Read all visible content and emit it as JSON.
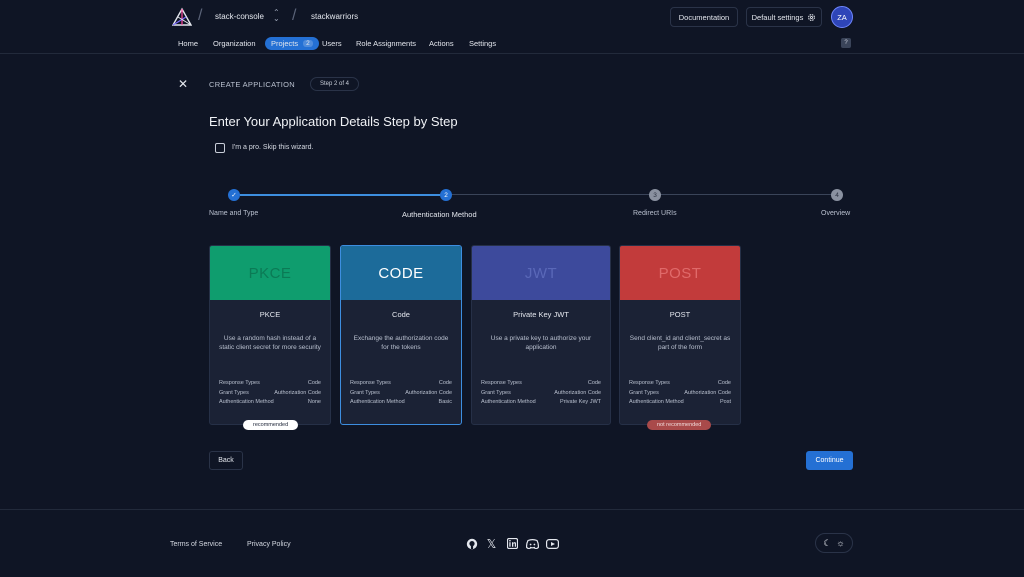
{
  "header": {
    "org_name": "stack-console",
    "instance_name": "stackwarriors",
    "documentation_label": "Documentation",
    "default_settings_label": "Default settings",
    "avatar_initials": "ZA"
  },
  "nav": {
    "items": [
      {
        "label": "Home"
      },
      {
        "label": "Organization"
      },
      {
        "label": "Projects",
        "count": "2"
      },
      {
        "label": "Users"
      },
      {
        "label": "Role Assignments"
      },
      {
        "label": "Actions"
      },
      {
        "label": "Settings"
      }
    ],
    "help_label": "?"
  },
  "wizard": {
    "close_icon": "close-icon",
    "create_label": "CREATE APPLICATION",
    "step_indicator": "Step 2 of 4",
    "title": "Enter Your Application Details Step by Step",
    "skip_label": "I'm a pro. Skip this wizard.",
    "skip_checked": false,
    "steps": [
      {
        "number": "1",
        "label": "Name and Type",
        "state": "done"
      },
      {
        "number": "2",
        "label": "Authentication Method",
        "state": "current"
      },
      {
        "number": "3",
        "label": "Redirect URIs",
        "state": "pending"
      },
      {
        "number": "4",
        "label": "Overview",
        "state": "pending"
      }
    ],
    "prop_labels": [
      "Response Types",
      "Grant Types",
      "Authentication Method"
    ],
    "cards": [
      {
        "banner": "PKCE",
        "name": "PKCE",
        "description": "Use a random hash instead of a static client secret for more security",
        "response_types": "Code",
        "grant_types": "Authorization Code",
        "auth_method": "None",
        "badge": "recommended",
        "color": "#0f9d6e"
      },
      {
        "banner": "CODE",
        "name": "Code",
        "description": "Exchange the authorization code for the tokens",
        "response_types": "Code",
        "grant_types": "Authorization Code",
        "auth_method": "Basic",
        "color": "#1c6b9a",
        "selected": true
      },
      {
        "banner": "JWT",
        "name": "Private Key JWT",
        "description": "Use a private key to authorize your application",
        "response_types": "Code",
        "grant_types": "Authorization Code",
        "auth_method": "Private Key JWT",
        "color": "#3d4a9c"
      },
      {
        "banner": "POST",
        "name": "POST",
        "description": "Send client_id and client_secret as part of the form",
        "response_types": "Code",
        "grant_types": "Authorization Code",
        "auth_method": "Post",
        "badge": "not recommended",
        "color": "#c23b3b"
      }
    ],
    "back_label": "Back",
    "continue_label": "Continue"
  },
  "footer": {
    "terms_label": "Terms of Service",
    "privacy_label": "Privacy Policy",
    "social_icons": [
      "github-icon",
      "x-icon",
      "linkedin-icon",
      "discord-icon",
      "youtube-icon"
    ],
    "theme_icons": [
      "moon-icon",
      "sun-icon"
    ]
  },
  "colors": {
    "background": "#0f1525",
    "accent": "#2470d4",
    "card_bg": "#1b2235",
    "recommended_badge": "#ffffff",
    "not_recommended_badge": "#a94a4a"
  }
}
